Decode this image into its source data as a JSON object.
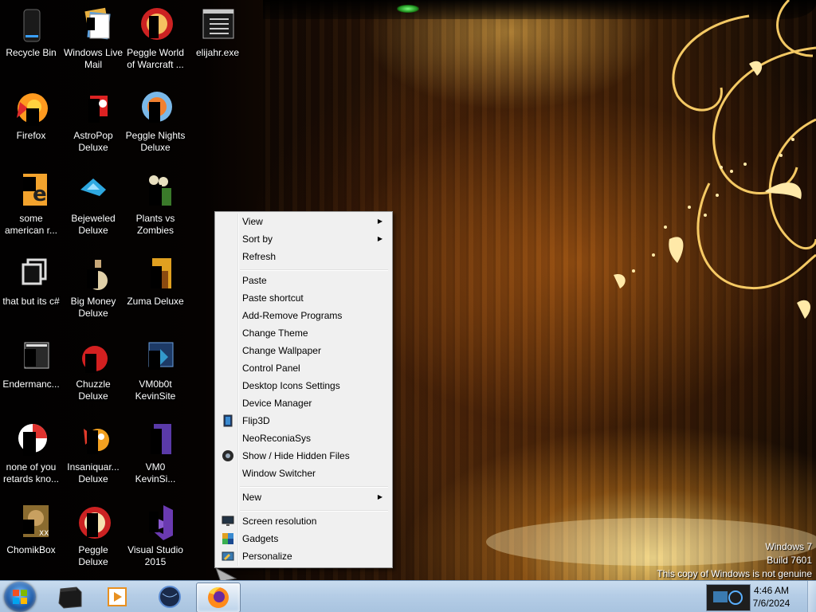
{
  "desktop": {
    "icons": [
      {
        "label": "Recycle Bin",
        "icon": "recycle-bin-icon"
      },
      {
        "label": "Windows Live Mail",
        "icon": "windows-live-mail-icon"
      },
      {
        "label": "Peggle World of Warcraft ...",
        "icon": "peggle-wow-icon"
      },
      {
        "label": "elijahr.exe",
        "icon": "exe-file-icon"
      },
      {
        "label": "Firefox",
        "icon": "firefox-icon"
      },
      {
        "label": "AstroPop Deluxe",
        "icon": "astropop-icon"
      },
      {
        "label": "Peggle Nights Deluxe",
        "icon": "peggle-nights-icon"
      },
      {
        "label": "some american r...",
        "icon": "shortcut-icon"
      },
      {
        "label": "Bejeweled Deluxe",
        "icon": "bejeweled-icon"
      },
      {
        "label": "Plants vs Zombies",
        "icon": "plants-vs-zombies-icon"
      },
      {
        "label": "that but its c#",
        "icon": "file-copy-icon"
      },
      {
        "label": "Big Money Deluxe",
        "icon": "big-money-icon"
      },
      {
        "label": "Zuma Deluxe",
        "icon": "zuma-icon"
      },
      {
        "label": "Endermanc...",
        "icon": "app-window-icon"
      },
      {
        "label": "Chuzzle Deluxe",
        "icon": "chuzzle-icon"
      },
      {
        "label": "VM0b0t KevinSite",
        "icon": "vm-icon"
      },
      {
        "label": "none of you retards kno...",
        "icon": "chrome-like-icon"
      },
      {
        "label": "Insaniquar... Deluxe",
        "icon": "insaniquarium-icon"
      },
      {
        "label": "VM0 KevinSi...",
        "icon": "vm-file-icon"
      },
      {
        "label": "ChomikBox",
        "icon": "chomikbox-icon"
      },
      {
        "label": "Peggle Deluxe",
        "icon": "peggle-icon"
      },
      {
        "label": "Visual Studio 2015",
        "icon": "visual-studio-icon"
      }
    ]
  },
  "context_menu": {
    "view": "View",
    "sort_by": "Sort by",
    "refresh": "Refresh",
    "paste": "Paste",
    "paste_shortcut": "Paste shortcut",
    "add_remove": "Add-Remove Programs",
    "change_theme": "Change Theme",
    "change_wallpaper": "Change Wallpaper",
    "control_panel": "Control Panel",
    "desktop_icons": "Desktop Icons Settings",
    "device_manager": "Device Manager",
    "flip3d": "Flip3D",
    "neoreconia": "NeoReconiaSys",
    "show_hide": "Show / Hide Hidden Files",
    "window_switcher": "Window Switcher",
    "new": "New",
    "screen_resolution": "Screen resolution",
    "gadgets": "Gadgets",
    "personalize": "Personalize",
    "submenu_arrow": "▶"
  },
  "watermark": {
    "line1": "Windows 7",
    "line2": "Build 7601",
    "line3": "This copy of Windows is not genuine"
  },
  "taskbar": {
    "time": "4:46 AM",
    "date": "7/6/2024",
    "pinned": [
      "terminal-icon",
      "media-player-icon",
      "globe-icon",
      "firefox-icon"
    ]
  },
  "colors": {
    "menu_bg": "#f0f0f0",
    "taskbar_bg": "#b5cde6",
    "desktop_bg": "#000000"
  }
}
